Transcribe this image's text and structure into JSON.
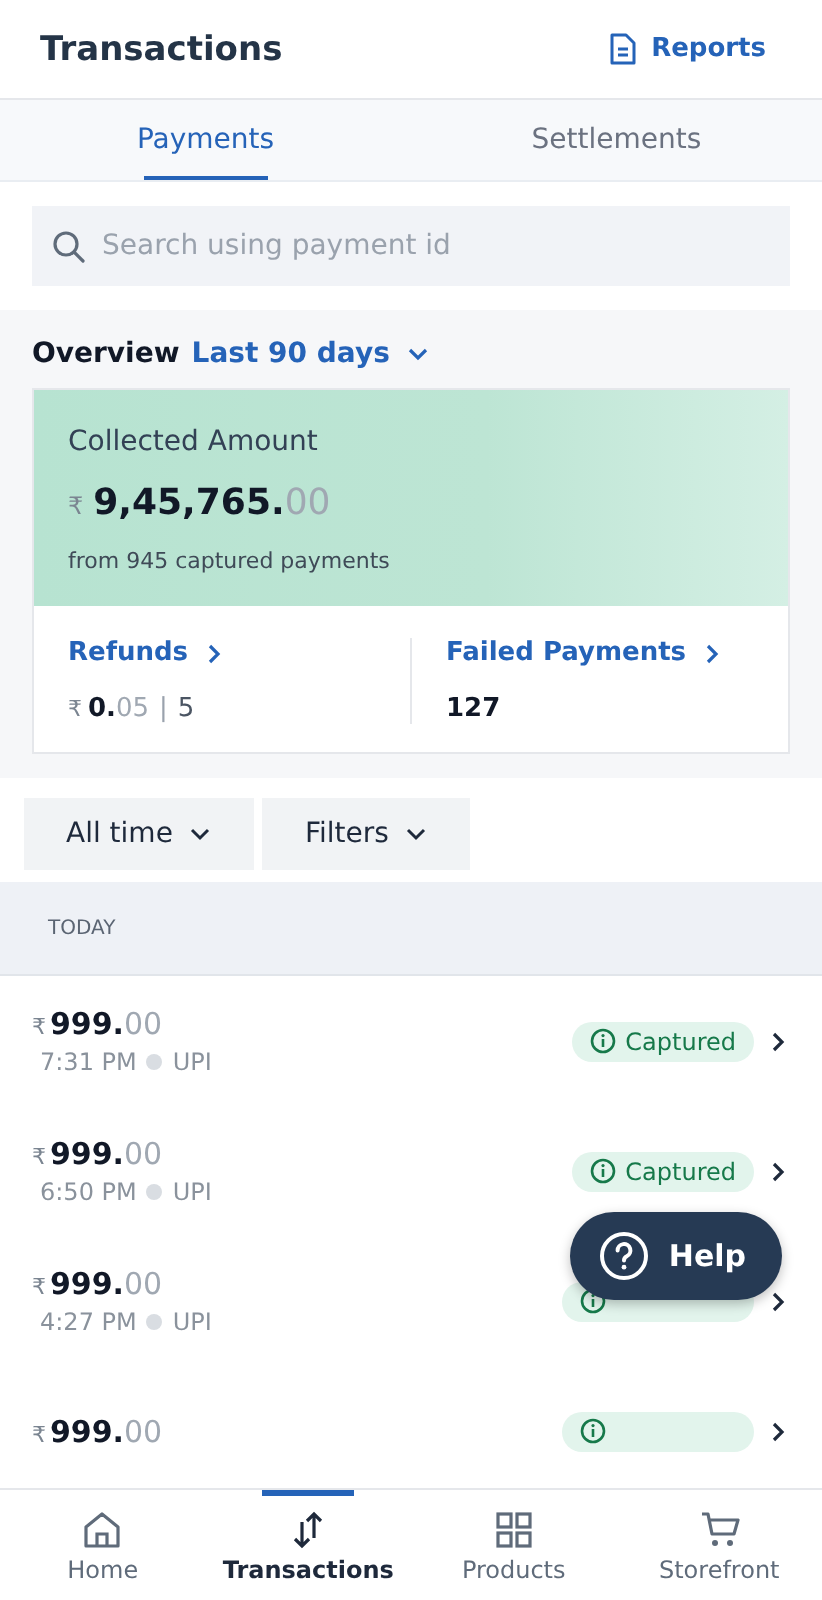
{
  "header": {
    "title": "Transactions",
    "reports_link": "Reports"
  },
  "tabs": [
    {
      "label": "Payments",
      "selected": true
    },
    {
      "label": "Settlements",
      "selected": false
    }
  ],
  "search": {
    "placeholder": "Search using payment id"
  },
  "overview": {
    "label": "Overview",
    "period": "Last 90 days",
    "collected": {
      "title": "Collected Amount",
      "currency": "₹",
      "amount": "**9,45,765.**00",
      "caption": "from 945 captured payments"
    },
    "refunds": {
      "title": "Refunds",
      "currency": "₹",
      "amount": "**0.**05",
      "separator": "|",
      "count": "5"
    },
    "failed": {
      "title": "Failed Payments",
      "count": "127"
    }
  },
  "filters": [
    {
      "label": "All time"
    },
    {
      "label": "Filters"
    }
  ],
  "section_header": "TODAY",
  "payments": [
    {
      "currency": "₹",
      "amount": "**999.**00",
      "time": "7:31 PM",
      "method": "UPI",
      "status": "Captured"
    },
    {
      "currency": "₹",
      "amount": "**999.**00",
      "time": "6:50 PM",
      "method": "UPI",
      "status": "Captured"
    },
    {
      "currency": "₹",
      "amount": "**999.**00",
      "time": "4:27 PM",
      "method": "UPI"
    },
    {
      "currency": "₹",
      "amount": "**999.**00"
    }
  ],
  "help_button": "Help",
  "bottom_nav": [
    {
      "label": "Home",
      "kind": "home",
      "selected": false
    },
    {
      "label": "Transactions",
      "kind": "transfer",
      "selected": true
    },
    {
      "label": "Products",
      "kind": "grid",
      "selected": false
    },
    {
      "label": "Storefront",
      "kind": "cart",
      "selected": false
    }
  ]
}
